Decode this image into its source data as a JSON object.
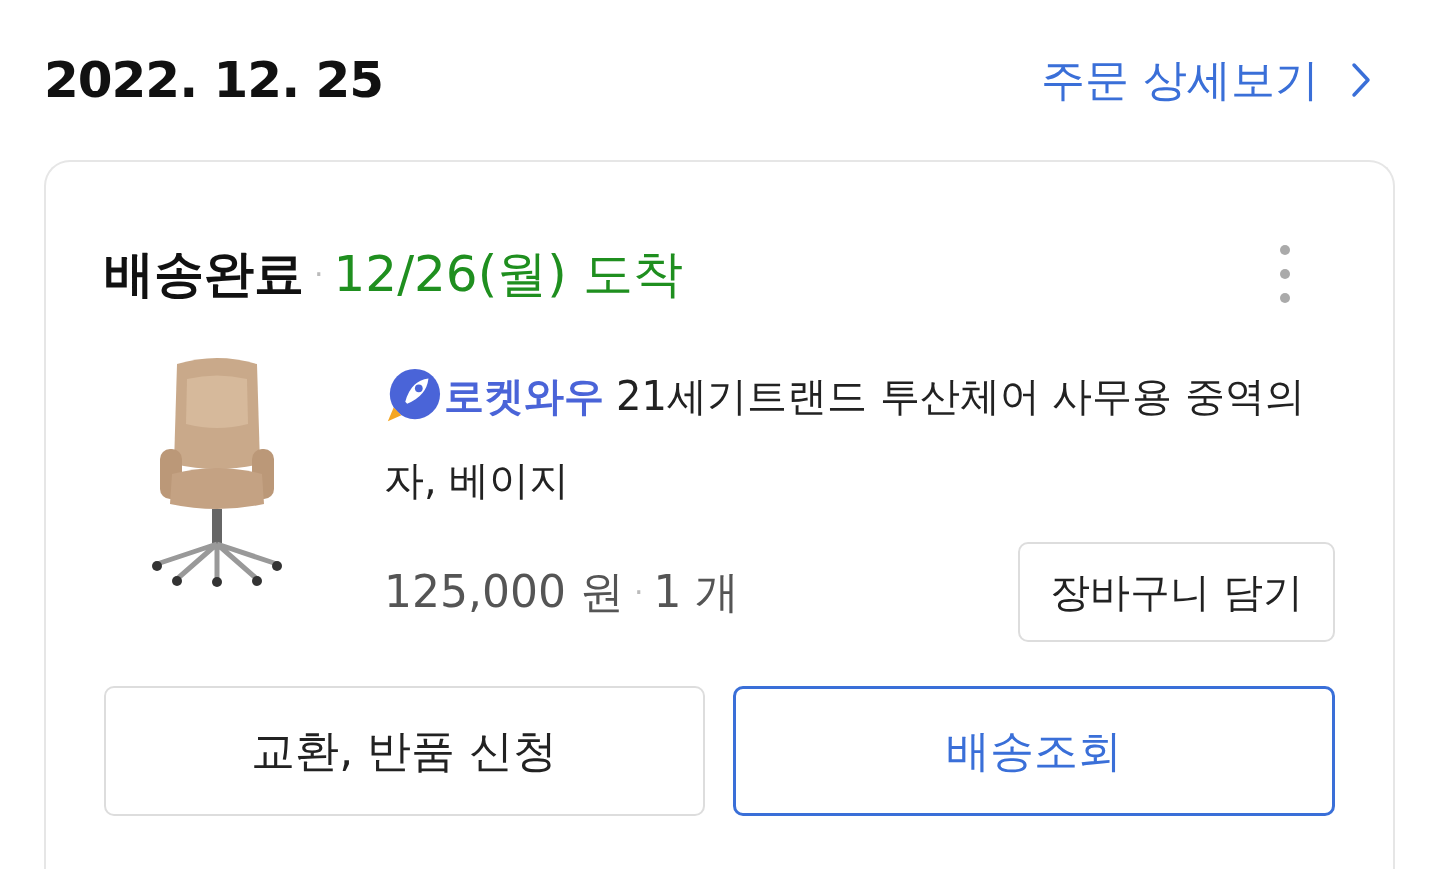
{
  "date": "2022. 12. 25",
  "detail_link": {
    "label": "주문 상세보기"
  },
  "order": {
    "status": "배송완료",
    "separator": "·",
    "arrival": "12/26(월) 도착",
    "product": {
      "badge": "로켓와우",
      "title_lines": [
        "21세기트랜드 투산체어 사무용 중역의",
        "자, 베이지"
      ],
      "price": "125,000 원",
      "separator": "·",
      "quantity": "1 개",
      "cart_button": "장바구니 담기"
    },
    "actions": [
      {
        "label": "교환, 반품 신청",
        "kind": "secondary"
      },
      {
        "label": "배송조회",
        "kind": "primary"
      }
    ]
  }
}
